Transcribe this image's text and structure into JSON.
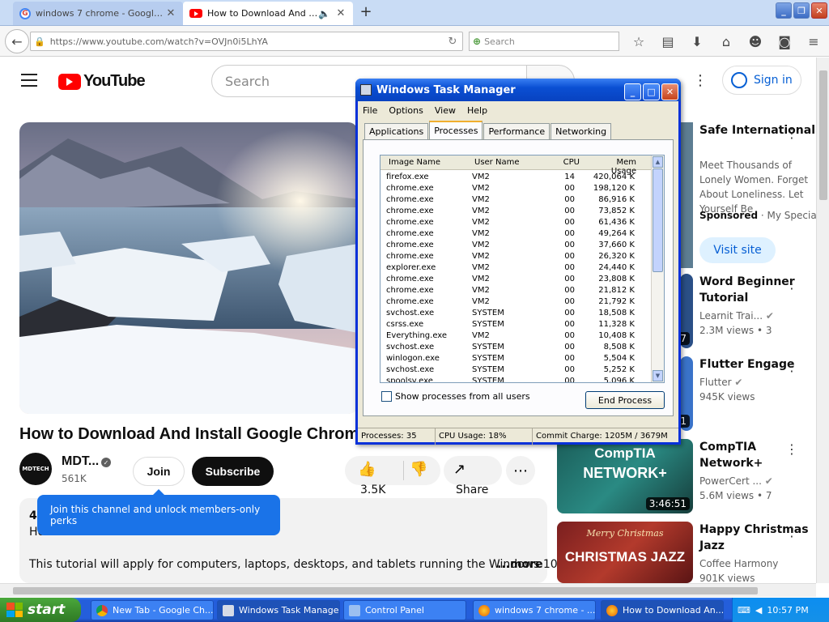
{
  "browser": {
    "tabs": [
      {
        "title": "windows 7 chrome - Google S...",
        "icon": "google-icon",
        "active": false
      },
      {
        "title": "How to Download And In...",
        "icon": "youtube-icon",
        "active": true
      }
    ],
    "url": "https://www.youtube.com/watch?v=OVJn0i5LhYA",
    "search_placeholder": "Search"
  },
  "youtube": {
    "logo_text": "YouTube",
    "search_placeholder": "Search",
    "signin_label": "Sign in",
    "video_title": "How to Download And Install Google Chrome o",
    "channel": {
      "name": "MDT...",
      "subscribers": "561K",
      "avatar_text": "MDTECH"
    },
    "join_label": "Join",
    "subscribe_label": "Subscribe",
    "like_count": "3.5K",
    "share_label": "Share",
    "tooltip": "Join this channel and unlock members-only perks",
    "description": {
      "line1": "4:",
      "line2": "Ho",
      "line3": "This tutorial will apply for computers, laptops, desktops, and tablets running the Windows 10,",
      "more": "...more"
    },
    "ad": {
      "title": "Safe International Dati Site",
      "body": "Meet Thousands of Lonely Women. Forget About Loneliness. Let Yourself Be",
      "sponsored": "Sponsored",
      "advertiser": "My Special D",
      "cta": "Visit site"
    },
    "recommendations": [
      {
        "title": "Word Beginner Tutorial",
        "channel": "Learnit Trai...",
        "views": "2.3M views",
        "age": "3",
        "duration": "7"
      },
      {
        "title": "Flutter Engage",
        "channel": "Flutter",
        "views": "945K views",
        "age": "",
        "duration": "1"
      },
      {
        "title": "CompTIA Network+",
        "channel": "PowerCert ...",
        "views": "5.6M views",
        "age": "7",
        "duration": "3:46:51",
        "thumb_text1": "CompTIA",
        "thumb_text2": "NETWORK+"
      },
      {
        "title": "Happy Christmas Jazz",
        "channel": "Coffee Harmony",
        "views": "901K views",
        "age": "",
        "thumb_text1": "Merry Christmas",
        "thumb_text2": "CHRISTMAS JAZZ"
      }
    ]
  },
  "task_manager": {
    "title": "Windows Task Manager",
    "menu": [
      "File",
      "Options",
      "View",
      "Help"
    ],
    "tabs": [
      "Applications",
      "Processes",
      "Performance",
      "Networking"
    ],
    "active_tab": "Processes",
    "columns": [
      "Image Name",
      "User Name",
      "CPU",
      "Mem Usage"
    ],
    "processes": [
      [
        "firefox.exe",
        "VM2",
        "14",
        "420,064 K"
      ],
      [
        "chrome.exe",
        "VM2",
        "00",
        "198,120 K"
      ],
      [
        "chrome.exe",
        "VM2",
        "00",
        "86,916 K"
      ],
      [
        "chrome.exe",
        "VM2",
        "00",
        "73,852 K"
      ],
      [
        "chrome.exe",
        "VM2",
        "00",
        "61,436 K"
      ],
      [
        "chrome.exe",
        "VM2",
        "00",
        "49,264 K"
      ],
      [
        "chrome.exe",
        "VM2",
        "00",
        "37,660 K"
      ],
      [
        "chrome.exe",
        "VM2",
        "00",
        "26,320 K"
      ],
      [
        "explorer.exe",
        "VM2",
        "00",
        "24,440 K"
      ],
      [
        "chrome.exe",
        "VM2",
        "00",
        "23,808 K"
      ],
      [
        "chrome.exe",
        "VM2",
        "00",
        "21,812 K"
      ],
      [
        "chrome.exe",
        "VM2",
        "00",
        "21,792 K"
      ],
      [
        "svchost.exe",
        "SYSTEM",
        "00",
        "18,508 K"
      ],
      [
        "csrss.exe",
        "SYSTEM",
        "00",
        "11,328 K"
      ],
      [
        "Everything.exe",
        "VM2",
        "00",
        "10,408 K"
      ],
      [
        "svchost.exe",
        "SYSTEM",
        "00",
        "8,508 K"
      ],
      [
        "winlogon.exe",
        "SYSTEM",
        "00",
        "5,504 K"
      ],
      [
        "svchost.exe",
        "SYSTEM",
        "00",
        "5,252 K"
      ],
      [
        "spoolsv.exe",
        "SYSTEM",
        "00",
        "5,096 K"
      ]
    ],
    "show_all_label": "Show processes from all users",
    "end_process_label": "End Process",
    "status": {
      "processes": "Processes: 35",
      "cpu": "CPU Usage: 18%",
      "commit": "Commit Charge: 1205M / 3679M"
    }
  },
  "taskbar": {
    "start_label": "start",
    "items": [
      {
        "label": "New Tab - Google Ch...",
        "icon": "chrome-icon"
      },
      {
        "label": "Windows Task Manager",
        "icon": "taskmgr-icon"
      },
      {
        "label": "Control Panel",
        "icon": "control-panel-icon"
      },
      {
        "label": "windows 7 chrome - ...",
        "icon": "firefox-icon"
      },
      {
        "label": "How to Download An...",
        "icon": "firefox-icon"
      }
    ],
    "clock": "10:57 PM"
  }
}
